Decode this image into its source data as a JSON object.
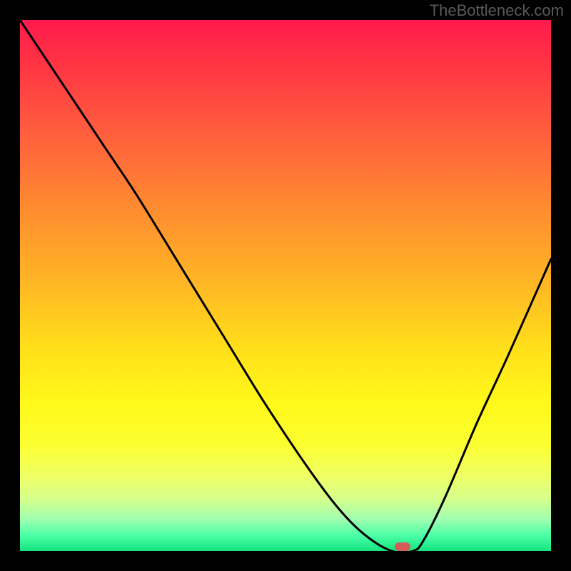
{
  "watermark": "TheBottleneck.com",
  "colors": {
    "curve": "#000000",
    "marker": "#d65a5a",
    "frame_bg": "#000000"
  },
  "chart_data": {
    "type": "line",
    "title": "",
    "xlabel": "",
    "ylabel": "",
    "x_range": [
      0,
      1
    ],
    "y_range": [
      0,
      1
    ],
    "series": [
      {
        "name": "curve",
        "x": [
          0.0,
          0.08,
          0.16,
          0.22,
          0.3,
          0.38,
          0.46,
          0.54,
          0.6,
          0.65,
          0.7,
          0.74,
          0.76,
          0.8,
          0.86,
          0.92,
          1.0
        ],
        "y": [
          1.0,
          0.88,
          0.76,
          0.67,
          0.54,
          0.41,
          0.28,
          0.16,
          0.08,
          0.03,
          0.0,
          0.0,
          0.02,
          0.1,
          0.24,
          0.37,
          0.55
        ]
      }
    ],
    "marker": {
      "x": 0.72,
      "y": 0.005
    },
    "gradient_stops": [
      {
        "pos": 0.0,
        "color": "#ff1a4d"
      },
      {
        "pos": 0.5,
        "color": "#ffe01a"
      },
      {
        "pos": 1.0,
        "color": "#14e47e"
      }
    ]
  }
}
